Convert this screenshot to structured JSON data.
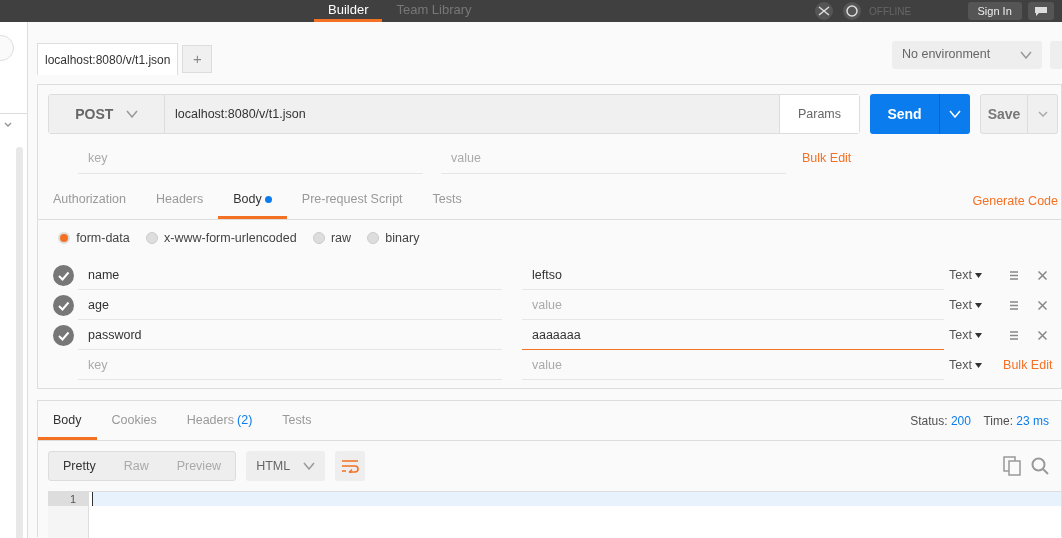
{
  "top_nav": {
    "tabs": [
      {
        "label": "Builder",
        "selected": true
      },
      {
        "label": "Team Library",
        "selected": false
      }
    ],
    "status": "OFFLINE",
    "sign_in": "Sign In"
  },
  "request_tabs": [
    {
      "label": "localhost:8080/v/t1.json",
      "selected": true
    }
  ],
  "new_tab": "+",
  "environment": "No environment",
  "request": {
    "method": "POST",
    "url": "localhost:8080/v/t1.json",
    "params": "Params",
    "send": "Send",
    "save": "Save"
  },
  "url_params": {
    "key_placeholder": "key",
    "value_placeholder": "value",
    "bulk_edit": "Bulk Edit"
  },
  "tabs": [
    {
      "label": "Authorization",
      "selected": false,
      "dot": false
    },
    {
      "label": "Headers",
      "selected": false,
      "dot": false
    },
    {
      "label": "Body",
      "selected": true,
      "dot": true
    },
    {
      "label": "Pre-request Script",
      "selected": false,
      "dot": false
    },
    {
      "label": "Tests",
      "selected": false,
      "dot": false
    }
  ],
  "generate_code": "Generate Code",
  "body_modes": [
    {
      "label": "form-data",
      "selected": true
    },
    {
      "label": "x-www-form-urlencoded",
      "selected": false
    },
    {
      "label": "raw",
      "selected": false
    },
    {
      "label": "binary",
      "selected": false
    }
  ],
  "form_rows": [
    {
      "checked": true,
      "key": "name",
      "value": "leftso",
      "type": "Text",
      "focused": false
    },
    {
      "checked": true,
      "key": "age",
      "value_placeholder": "value",
      "type": "Text",
      "focused": false
    },
    {
      "checked": true,
      "key": "password",
      "value": "aaaaaaa",
      "type": "Text",
      "focused": true
    }
  ],
  "new_row": {
    "key_placeholder": "key",
    "value_placeholder": "value",
    "type": "Text",
    "bulk_edit": "Bulk Edit"
  },
  "response": {
    "tabs": [
      {
        "label": "Body",
        "selected": true
      },
      {
        "label": "Cookies",
        "selected": false
      },
      {
        "label": "Headers",
        "count": "(2)",
        "selected": false
      },
      {
        "label": "Tests",
        "selected": false
      }
    ],
    "status_label": "Status:",
    "status": "200",
    "time_label": "Time:",
    "time": "23 ms",
    "views": [
      {
        "label": "Pretty",
        "selected": true
      },
      {
        "label": "Raw",
        "selected": false
      },
      {
        "label": "Preview",
        "selected": false
      }
    ],
    "format": "HTML",
    "line_numbers": [
      "1"
    ]
  }
}
